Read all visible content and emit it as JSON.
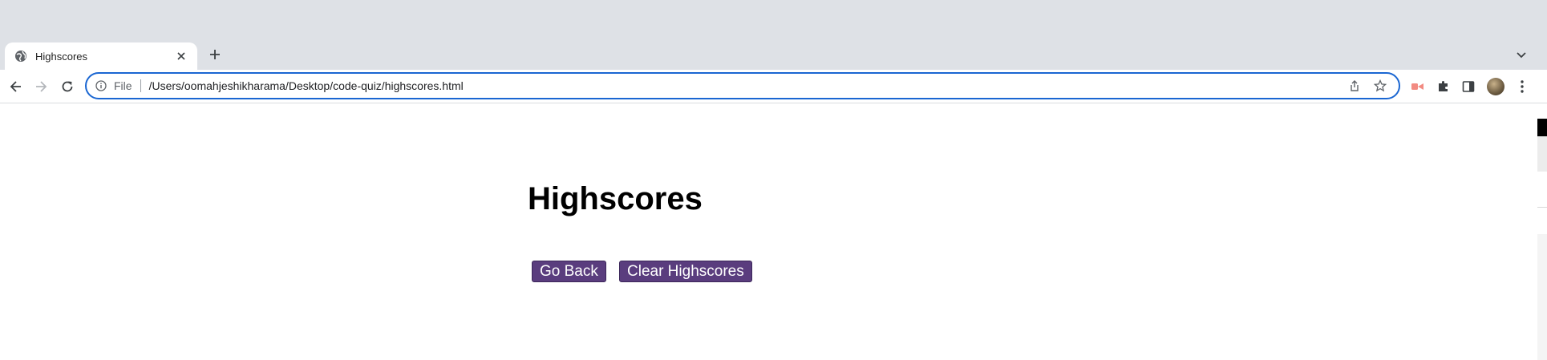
{
  "browser": {
    "tab": {
      "title": "Highscores",
      "favicon": "globe-icon"
    },
    "new_tab_icon": "plus-icon",
    "tab_search_icon": "chevron-down-icon",
    "nav": {
      "back_icon": "arrow-left-icon",
      "forward_icon": "arrow-right-icon",
      "reload_icon": "reload-icon"
    },
    "omnibox": {
      "scheme_label": "File",
      "url": "/Users/oomahjeshikharama/Desktop/code-quiz/highscores.html",
      "share_icon": "share-icon",
      "bookmark_icon": "star-icon"
    },
    "extensions": [
      "extension-red-icon",
      "puzzle-icon",
      "side-panel-icon"
    ],
    "menu_icon": "kebab-menu-icon",
    "accent_color": "#1a66d2"
  },
  "page": {
    "heading": "Highscores",
    "buttons": {
      "go_back": "Go Back",
      "clear": "Clear Highscores"
    },
    "button_color": "#5a3d7e"
  }
}
